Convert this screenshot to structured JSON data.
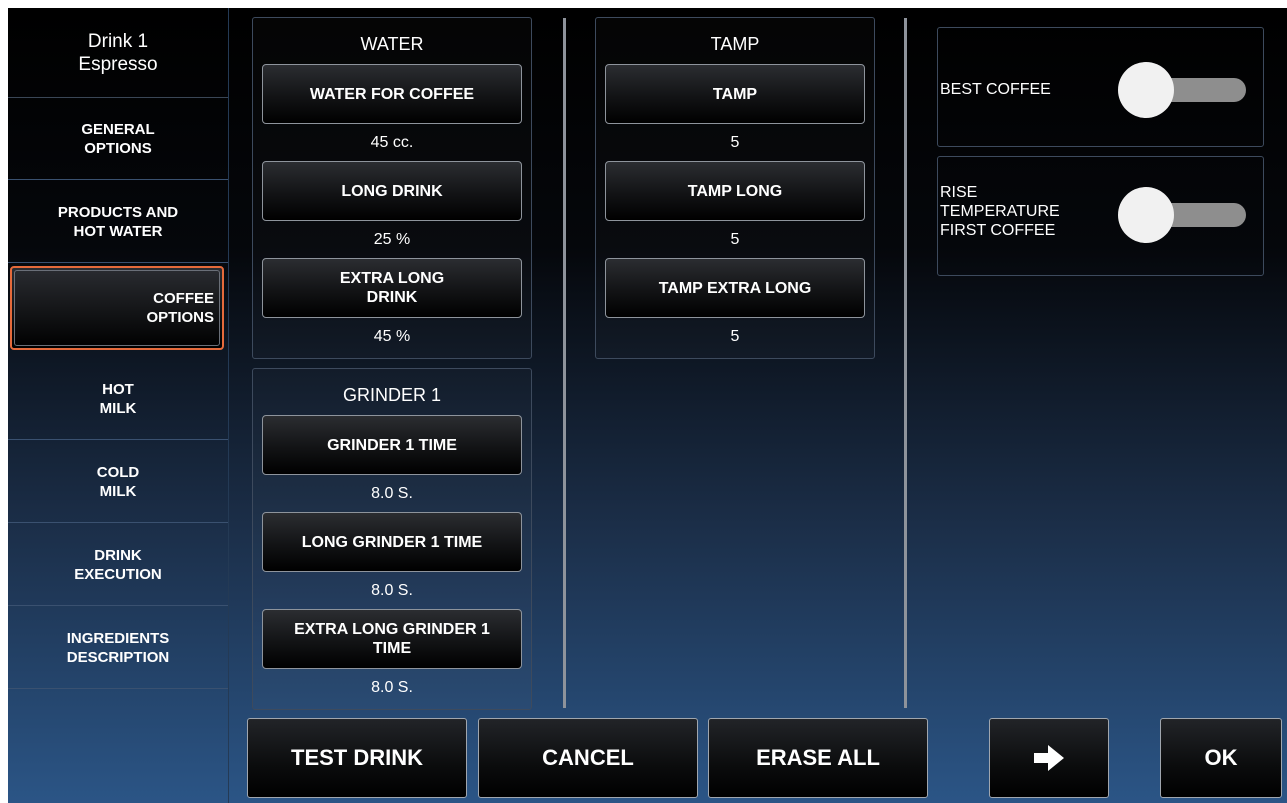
{
  "header": {
    "drink_name": "Drink 1",
    "drink_type": "Espresso"
  },
  "sidebar": {
    "items": [
      {
        "line1": "GENERAL",
        "line2": "OPTIONS"
      },
      {
        "line1": "PRODUCTS AND",
        "line2": "HOT WATER"
      },
      {
        "line1": "COFFEE",
        "line2": "OPTIONS",
        "selected": true
      },
      {
        "line1": "HOT",
        "line2": "MILK"
      },
      {
        "line1": "COLD",
        "line2": "MILK"
      },
      {
        "line1": "DRINK",
        "line2": "EXECUTION"
      },
      {
        "line1": "INGREDIENTS",
        "line2": "DESCRIPTION"
      }
    ]
  },
  "water": {
    "title": "WATER",
    "settings": [
      {
        "label": "WATER FOR COFFEE",
        "value": "45 cc."
      },
      {
        "label": "LONG DRINK",
        "value": "25 %"
      },
      {
        "label": "EXTRA LONG DRINK",
        "label_line1": "EXTRA LONG",
        "label_line2": "DRINK",
        "value": "45 %"
      }
    ]
  },
  "grinder": {
    "title": "GRINDER 1",
    "settings": [
      {
        "label": "GRINDER 1 TIME",
        "value": "8.0 S."
      },
      {
        "label": "LONG GRINDER 1 TIME",
        "value": "8.0 S."
      },
      {
        "label": "EXTRA LONG GRINDER 1 TIME",
        "label_line1": "EXTRA LONG GRINDER 1",
        "label_line2": "TIME",
        "value": "8.0 S."
      }
    ]
  },
  "tamp": {
    "title": "TAMP",
    "settings": [
      {
        "label": "TAMP",
        "value": "5"
      },
      {
        "label": "TAMP LONG",
        "value": "5"
      },
      {
        "label": "TAMP EXTRA LONG",
        "value": "5"
      }
    ]
  },
  "toggles": [
    {
      "label": "BEST COFFEE",
      "on": false
    },
    {
      "label_lines": [
        "RISE",
        "TEMPERATURE",
        "FIRST COFFEE"
      ],
      "on": false
    }
  ],
  "footer": {
    "test_drink": "TEST DRINK",
    "cancel": "CANCEL",
    "erase_all": "ERASE ALL",
    "next_icon": "arrow-right-icon",
    "ok": "OK"
  },
  "colors": {
    "selected_border": "#e56a3b",
    "toggle_track": "#8e8e8e",
    "toggle_knob": "#f1f1f1"
  }
}
